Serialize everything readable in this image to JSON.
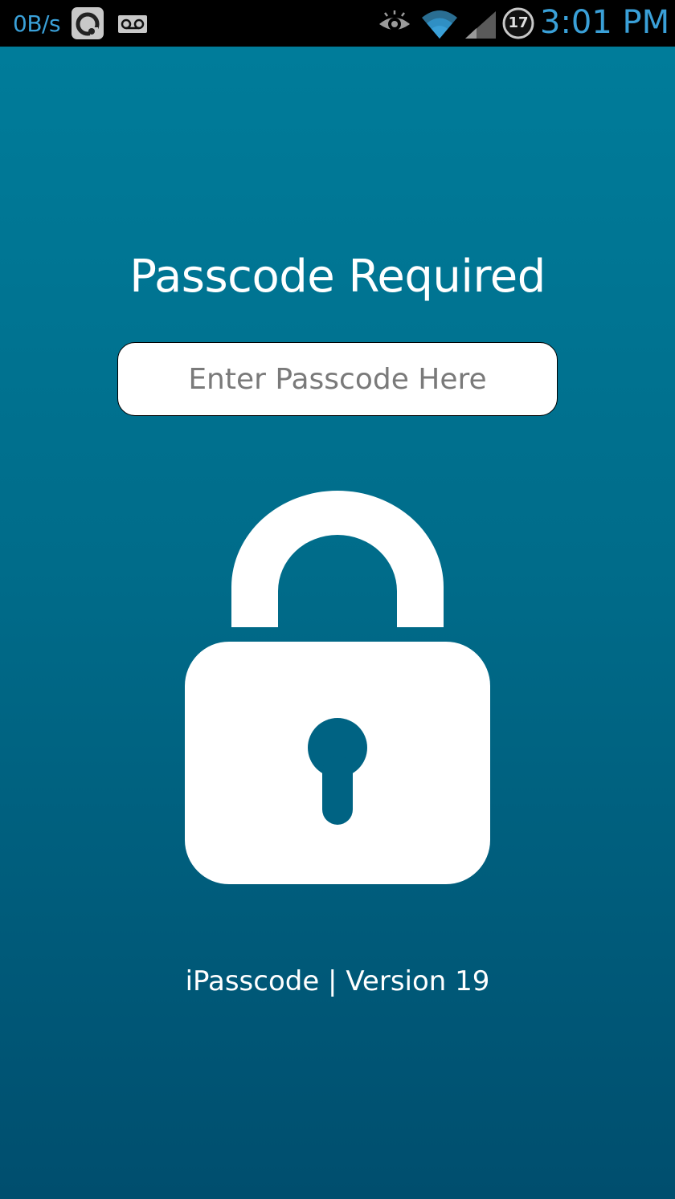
{
  "status_bar": {
    "network_speed": "0B/s",
    "battery_level": "17",
    "time": "3:01 PM",
    "icons": [
      "app-notification-icon",
      "voicemail-icon",
      "eye-icon",
      "wifi-icon",
      "signal-icon",
      "battery-icon"
    ],
    "text_color": "#3aa0d8",
    "icon_color": "#9a9a9a"
  },
  "screen": {
    "title": "Passcode Required",
    "passcode_input": {
      "value": "",
      "placeholder": "Enter Passcode Here"
    },
    "lock_icon": "lock-icon",
    "footer": "iPasscode | Version 19"
  },
  "colors": {
    "background_top": "#007c9a",
    "background_bottom": "#004e6e",
    "text": "#ffffff",
    "input_background": "#ffffff",
    "placeholder": "#7a7a7a"
  }
}
